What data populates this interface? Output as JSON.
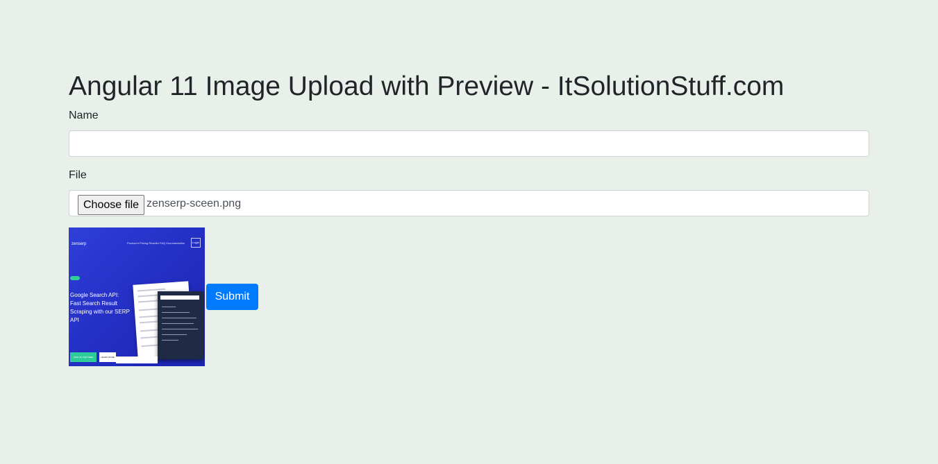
{
  "page": {
    "title": "Angular 11 Image Upload with Preview - ItSolutionStuff.com"
  },
  "form": {
    "name_label": "Name",
    "name_value": "",
    "file_label": "File",
    "choose_file_label": "Choose file",
    "selected_file_name": "zenserp-sceen.png",
    "submit_label": "Submit"
  },
  "preview_image": {
    "brand": "zenserp",
    "nav": "Product ▾   Pricing   Reseller   FAQ   Documentation",
    "login": "Login",
    "headline": "Google Search API: Fast Search Result Scraping with our SERP API",
    "cta_primary": "SIGN UP FOR FREE",
    "cta_secondary": "LEARN MORE"
  },
  "colors": {
    "background": "#e9f0ea",
    "primary": "#007bff",
    "preview_blue": "#2530c6"
  }
}
